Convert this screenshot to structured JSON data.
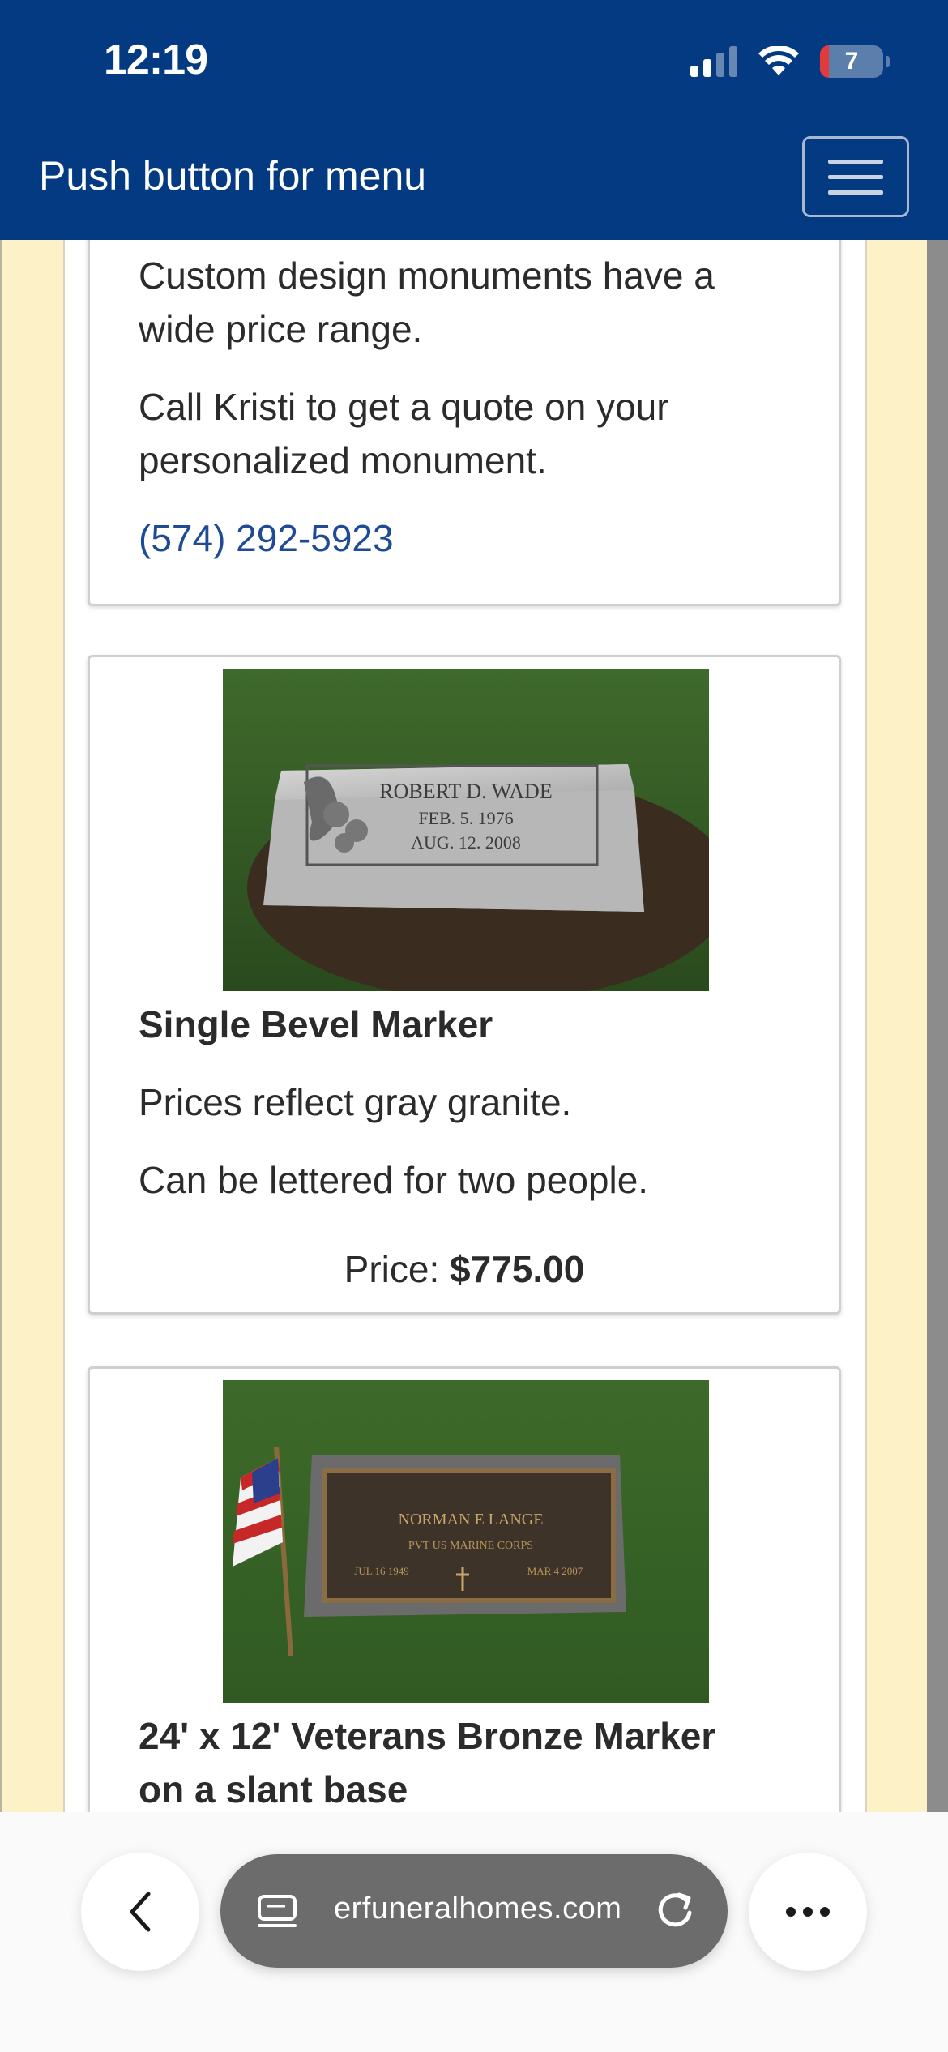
{
  "status": {
    "time": "12:19",
    "battery": "7"
  },
  "header": {
    "menu_label": "Push button for menu"
  },
  "card_contact": {
    "text1": [
      "Custom design monuments have a",
      "wide price range."
    ],
    "text2": [
      "Call Kristi to get a quote on your",
      "personalized monument."
    ],
    "phone": "(574) 292-5923"
  },
  "card_single_bevel": {
    "photo": {
      "name": "ROBERT D. WADE",
      "date1": "FEB. 5. 1976",
      "date2": "AUG. 12. 2008"
    },
    "title": "Single Bevel Marker",
    "desc1": "Prices reflect gray granite.",
    "desc2": "Can be lettered for two people.",
    "price_label": "Price: ",
    "price_value": "$775.00"
  },
  "card_veterans": {
    "photo": {
      "name": "NORMAN E LANGE",
      "line2": "PVT US MARINE CORPS",
      "date1": "JUL 16 1949",
      "date2": "MAR 4 2007"
    },
    "title": [
      "24' x 12' Veterans Bronze Marker",
      "on a slant base"
    ]
  },
  "browser": {
    "url": "erfuneralhomes.com"
  }
}
